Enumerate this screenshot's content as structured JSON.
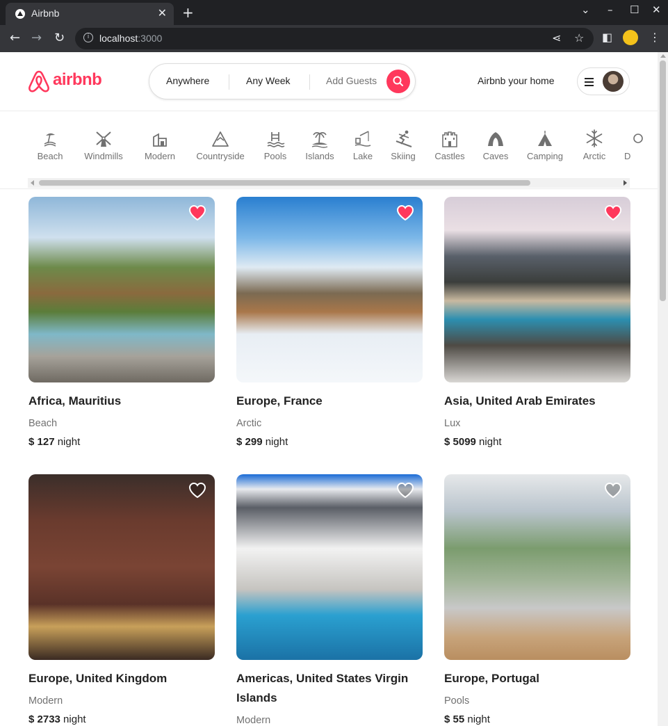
{
  "browser": {
    "tab_title": "Airbnb",
    "url_host": "localhost",
    "url_port": ":3000"
  },
  "header": {
    "logo_text": "airbnb",
    "search": {
      "where": "Anywhere",
      "when": "Any Week",
      "who": "Add Guests"
    },
    "host_link": "Airbnb your home"
  },
  "categories": [
    {
      "label": "Beach",
      "icon": "beach-icon"
    },
    {
      "label": "Windmills",
      "icon": "windmill-icon"
    },
    {
      "label": "Modern",
      "icon": "modern-house-icon"
    },
    {
      "label": "Countryside",
      "icon": "mountain-icon"
    },
    {
      "label": "Pools",
      "icon": "pool-icon"
    },
    {
      "label": "Islands",
      "icon": "island-icon"
    },
    {
      "label": "Lake",
      "icon": "lake-icon"
    },
    {
      "label": "Skiing",
      "icon": "skiing-icon"
    },
    {
      "label": "Castles",
      "icon": "castle-icon"
    },
    {
      "label": "Caves",
      "icon": "cave-icon"
    },
    {
      "label": "Camping",
      "icon": "camping-icon"
    },
    {
      "label": "Arctic",
      "icon": "snowflake-icon"
    },
    {
      "label": "D",
      "icon": "desert-icon"
    }
  ],
  "listings": [
    {
      "location": "Africa, Mauritius",
      "category": "Beach",
      "price_prefix": "$ ",
      "price": "127",
      "unit": " night",
      "favorited": true
    },
    {
      "location": "Europe, France",
      "category": "Arctic",
      "price_prefix": "$ ",
      "price": "299",
      "unit": " night",
      "favorited": true
    },
    {
      "location": "Asia, United Arab Emirates",
      "category": "Lux",
      "price_prefix": "$ ",
      "price": "5099",
      "unit": " night",
      "favorited": true
    },
    {
      "location": "Europe, United Kingdom",
      "category": "Modern",
      "price_prefix": "$ ",
      "price": "2733",
      "unit": " night",
      "favorited": false
    },
    {
      "location": "Americas, United States Virgin Islands",
      "category": "Modern",
      "price_prefix": "$ ",
      "price": "",
      "unit": "",
      "favorited": false
    },
    {
      "location": "Europe, Portugal",
      "category": "Pools",
      "price_prefix": "$ ",
      "price": "55",
      "unit": " night",
      "favorited": false
    }
  ],
  "colors": {
    "brand": "#ff385c",
    "text": "#222222",
    "muted": "#717171"
  }
}
